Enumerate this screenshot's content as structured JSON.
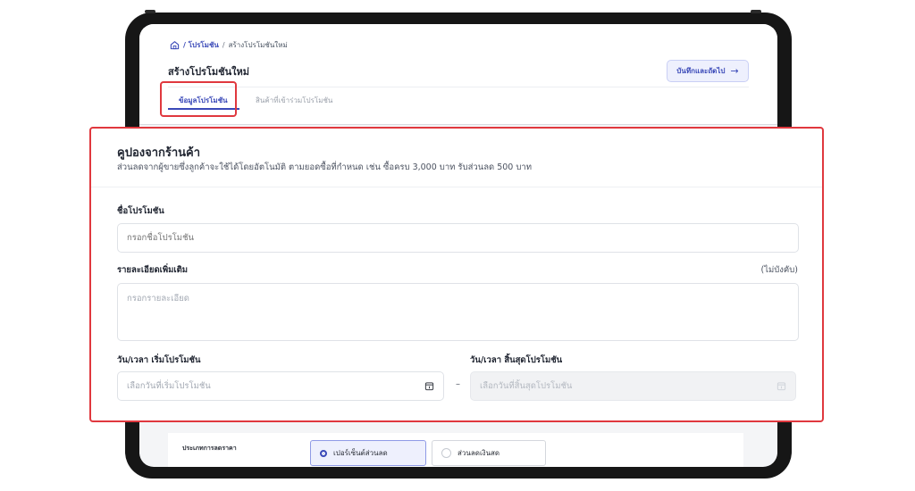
{
  "breadcrumb": {
    "home_icon": "home-icon",
    "link": "/ โปรโมชัน",
    "separator": "/",
    "current": "สร้างโปรโมชันใหม่"
  },
  "page": {
    "title": "สร้างโปรโมชันใหม่",
    "save_next_label": "บันทึกและถัดไป",
    "save_next_icon": "arrow-right-icon"
  },
  "tabs": [
    {
      "label": "ข้อมูลโปรโมชัน",
      "active": true
    },
    {
      "label": "สินค้าที่เข้าร่วมโปรโมชัน",
      "active": false
    }
  ],
  "coupon_form": {
    "title": "คูปองจากร้านค้า",
    "subtitle": "ส่วนลดจากผู้ขายซึ่งลูกค้าจะใช้ได้โดยอัตโนมัติ ตามยอดซื้อที่กำหนด เช่น ซื้อครบ 3,000 บาท รับส่วนลด 500 บาท",
    "name_label": "ชื่อโปรโมชัน",
    "name_placeholder": "กรอกชื่อโปรโมชัน",
    "name_value": "",
    "details_label": "รายละเอียดเพิ่มเติม",
    "details_optional": "(ไม่บังคับ)",
    "details_placeholder": "กรอกรายละเอียด",
    "details_value": "",
    "start_label": "วัน/เวลา เริ่มโปรโมชัน",
    "start_placeholder": "เลือกวันที่เริ่มโปรโมชัน",
    "end_label": "วัน/เวลา สิ้นสุดโปรโมชัน",
    "end_placeholder": "เลือกวันที่สิ้นสุดโปรโมชัน",
    "range_separator": "–",
    "calendar_icon": "calendar-icon"
  },
  "discount_type": {
    "label": "ประเภทการลดราคา",
    "options": [
      {
        "label": "เปอร์เซ็นต์ส่วนลด",
        "selected": true
      },
      {
        "label": "ส่วนลดเงินสด",
        "selected": false
      }
    ]
  },
  "colors": {
    "accent": "#3a49b8",
    "highlight": "#e0383e",
    "frame": "#161616"
  }
}
